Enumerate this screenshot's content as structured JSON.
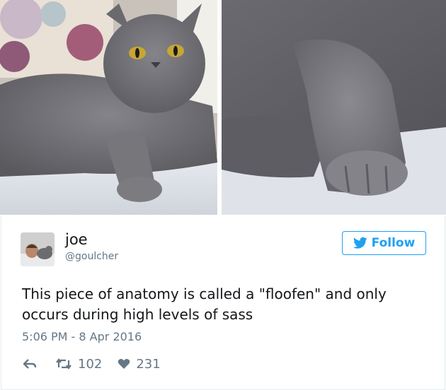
{
  "tweet": {
    "user_name": "joe",
    "user_handle": "@goulcher",
    "follow_label": "Follow",
    "text": "This piece of anatomy is called a \"floofen\" and only occurs during high levels of sass",
    "timestamp": "5:06 PM - 8 Apr 2016",
    "retweet_count": "102",
    "like_count": "231"
  },
  "icons": {
    "reply": "reply-icon",
    "retweet": "retweet-icon",
    "like": "heart-icon",
    "follow": "twitter-bird-icon"
  },
  "colors": {
    "accent": "#1da1f2",
    "text": "#14171a",
    "secondary_text": "#657786",
    "cat_fur": "#6e6d72"
  }
}
